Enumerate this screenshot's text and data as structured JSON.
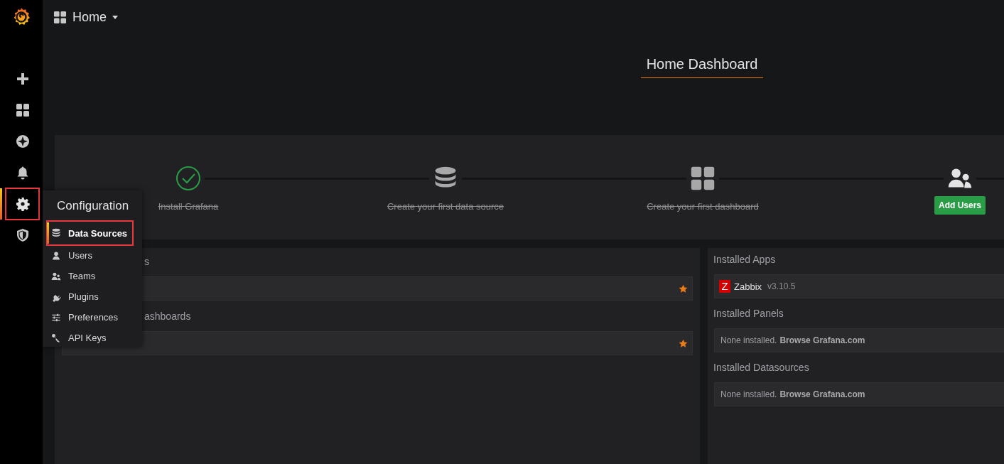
{
  "topbar": {
    "title": "Home"
  },
  "sidebar": {
    "items": [
      {
        "selected": false,
        "highlighted": false
      },
      {
        "selected": false,
        "highlighted": false
      },
      {
        "selected": false,
        "highlighted": false
      },
      {
        "selected": false,
        "highlighted": false
      },
      {
        "selected": true,
        "highlighted": true
      },
      {
        "selected": false,
        "highlighted": false
      }
    ]
  },
  "config_menu": {
    "title": "Configuration",
    "items": [
      {
        "label": "Data Sources",
        "selected": true,
        "highlighted": true
      },
      {
        "label": "Users",
        "selected": false,
        "highlighted": false
      },
      {
        "label": "Teams",
        "selected": false,
        "highlighted": false
      },
      {
        "label": "Plugins",
        "selected": false,
        "highlighted": false
      },
      {
        "label": "Preferences",
        "selected": false,
        "highlighted": false
      },
      {
        "label": "API Keys",
        "selected": false,
        "highlighted": false
      }
    ]
  },
  "dashboard_title": "Home Dashboard",
  "steps": [
    {
      "kind": "done",
      "label": "Install Grafana"
    },
    {
      "kind": "done",
      "label": "Create your first data source"
    },
    {
      "kind": "done",
      "label": "Create your first dashboard"
    },
    {
      "kind": "action",
      "button": "Add Users"
    }
  ],
  "left_panels": [
    {
      "title": "s",
      "rows": [
        {
          "starred": true
        }
      ]
    },
    {
      "title": "ashboards",
      "rows": [
        {
          "starred": true
        }
      ]
    }
  ],
  "installed_apps": {
    "title": "Installed Apps",
    "items": [
      {
        "icon_letter": "Z",
        "name": "Zabbix",
        "version": "v3.10.5"
      }
    ]
  },
  "installed_panels": {
    "title": "Installed Panels",
    "empty_text": "None installed.",
    "link": "Browse Grafana.com"
  },
  "installed_datasources": {
    "title": "Installed Datasources",
    "empty_text": "None installed.",
    "link": "Browse Grafana.com"
  }
}
